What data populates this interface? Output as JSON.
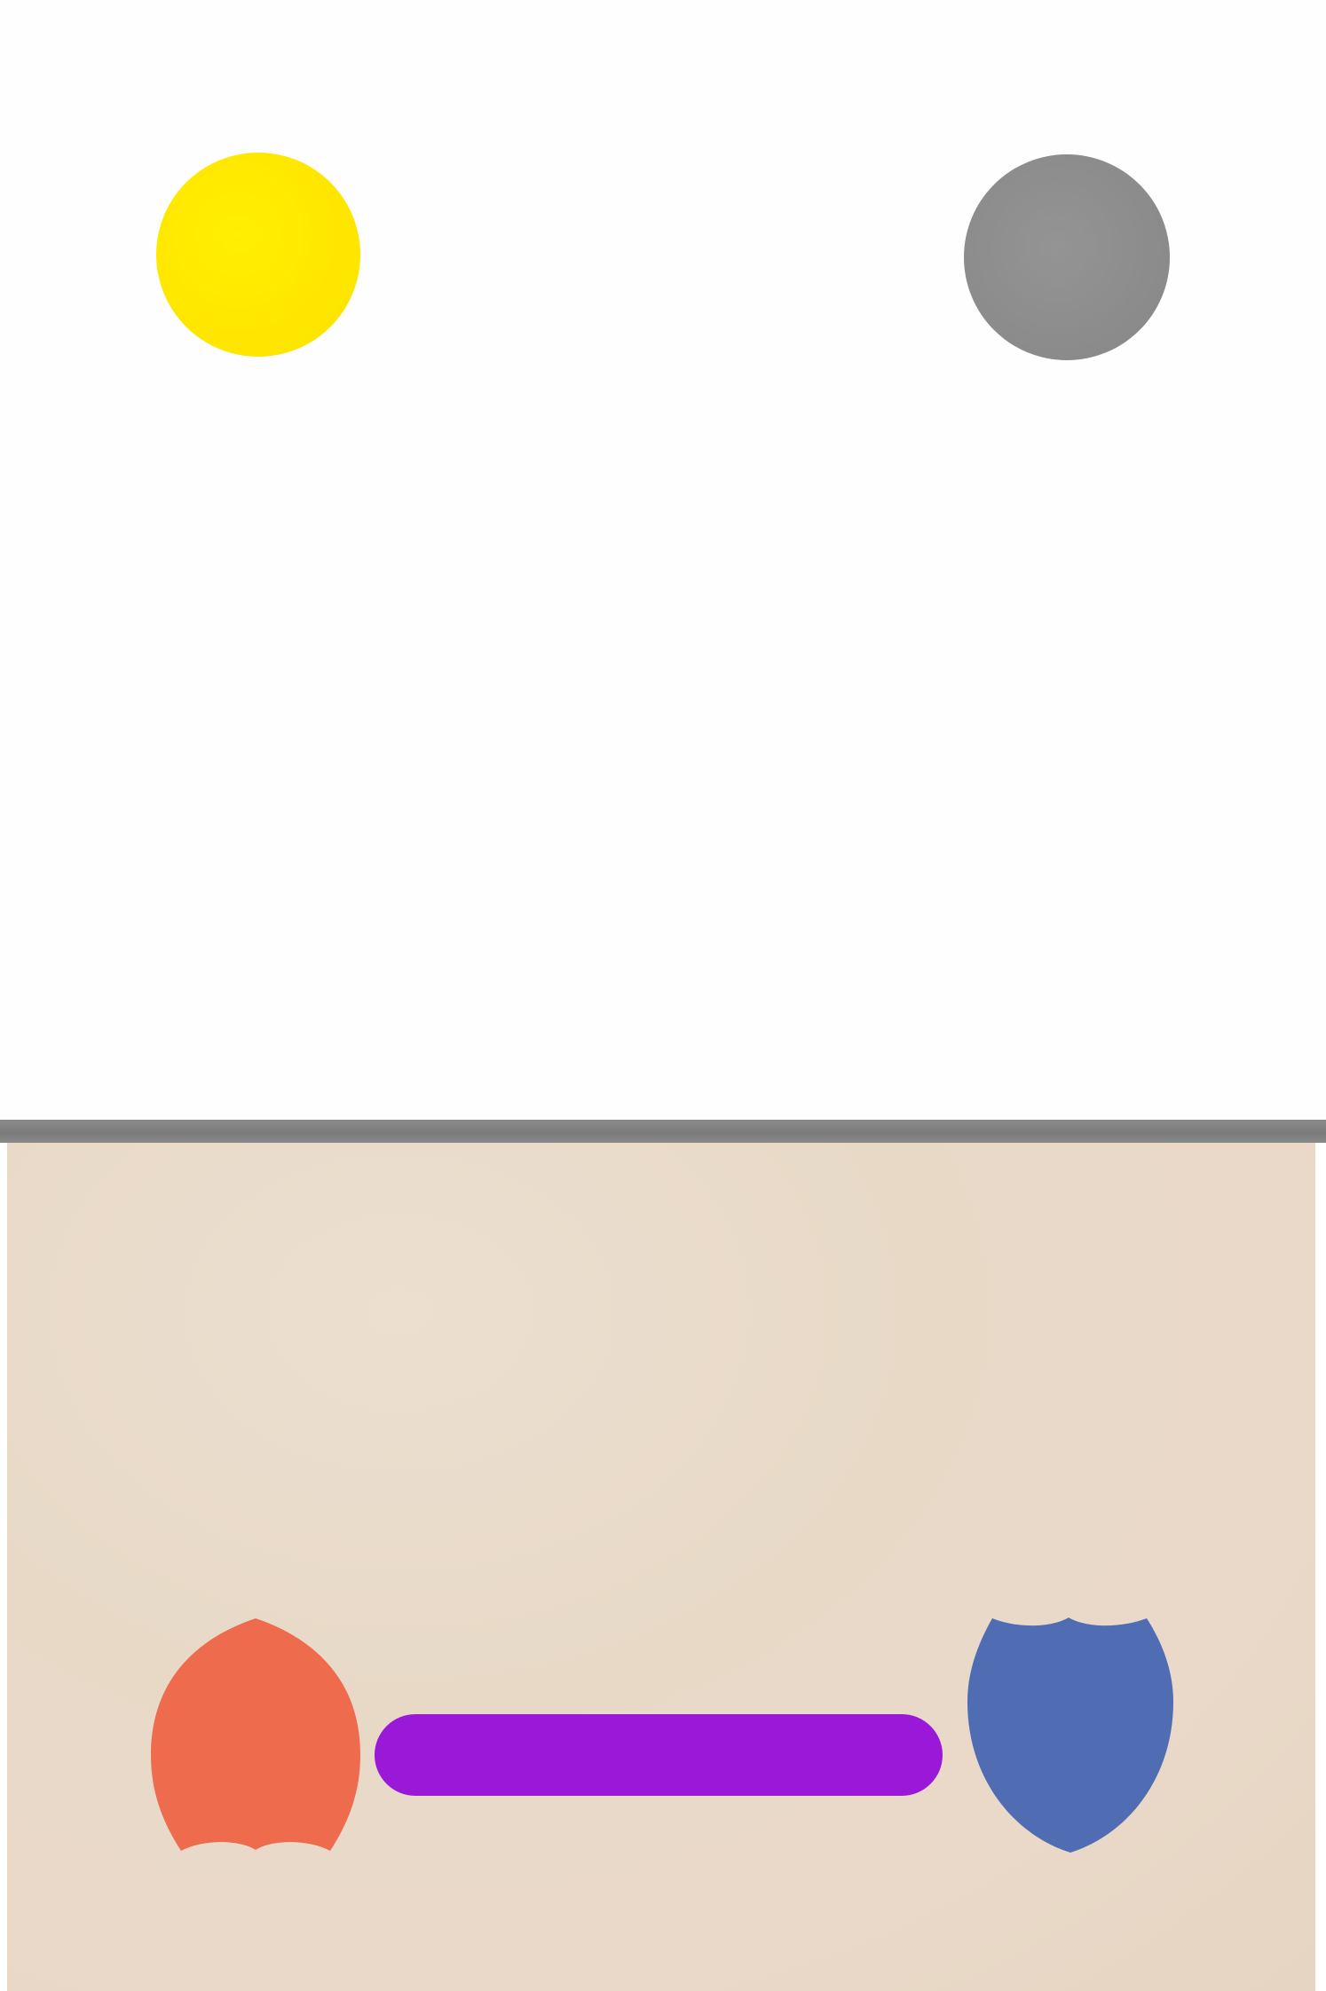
{
  "scene": {
    "sky_color": "#fefefe",
    "ground_color": "#e8dac8",
    "rail_color": "#808080"
  },
  "pieces": {
    "sun": {
      "color": "#ffec00",
      "shape": "circle"
    },
    "moon": {
      "color": "#8e8e8e",
      "shape": "circle"
    },
    "left_blob": {
      "color": "#ef6b4e",
      "shape": "notched-circle"
    },
    "bar": {
      "color": "#9a18d8",
      "shape": "capsule"
    },
    "right_blob": {
      "color": "#506db4",
      "shape": "notched-circle"
    }
  }
}
